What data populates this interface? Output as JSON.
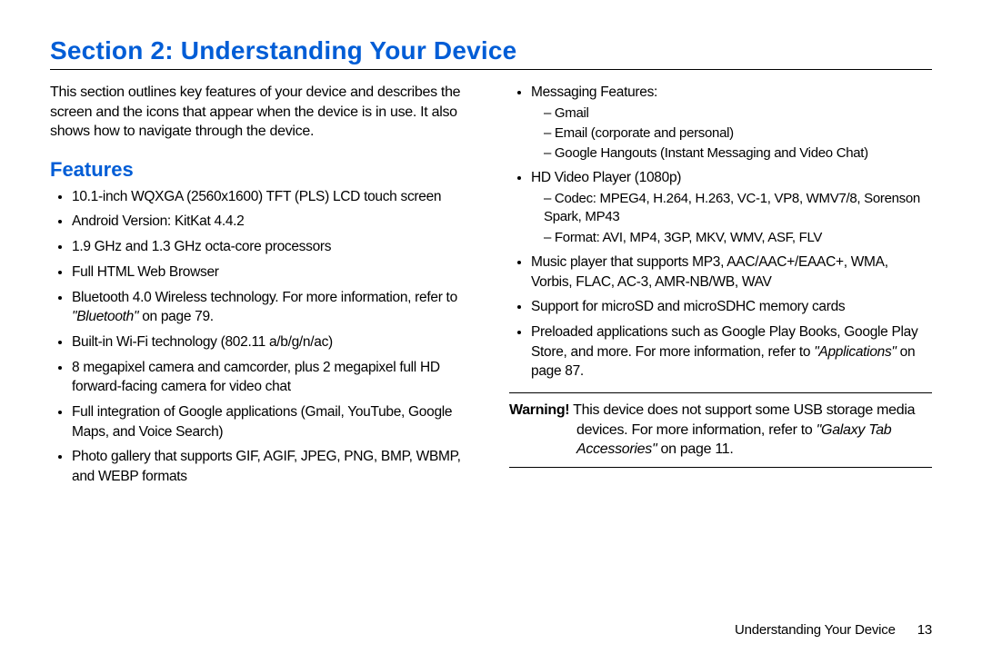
{
  "section_title": "Section 2: Understanding Your Device",
  "intro": "This section outlines key features of your device and describes the screen and the icons that appear when the device is in use. It also shows how to navigate through the device.",
  "features_heading": "Features",
  "left_bullets": {
    "b0": "10.1-inch WQXGA (2560x1600) TFT (PLS) LCD touch screen",
    "b1": "Android Version: KitKat 4.4.2",
    "b2": "1.9 GHz and 1.3 GHz octa-core processors",
    "b3": "Full HTML Web Browser",
    "b4_pre": "Bluetooth 4.0 Wireless technology. For more information, refer to ",
    "b4_ref": "\"Bluetooth\"",
    "b4_post": " on page 79.",
    "b5": "Built-in Wi-Fi technology (802.11 a/b/g/n/ac)",
    "b6": "8 megapixel camera and camcorder, plus 2 megapixel full HD forward-facing camera for video chat",
    "b7": "Full integration of Google applications (Gmail, YouTube, Google Maps, and Voice Search)",
    "b8": "Photo gallery that supports GIF, AGIF, JPEG, PNG, BMP, WBMP, and WEBP formats"
  },
  "right_bullets": {
    "msg_label": "Messaging Features:",
    "msg_items": {
      "m0": "Gmail",
      "m1": "Email (corporate and personal)",
      "m2": "Google Hangouts (Instant Messaging and Video Chat)"
    },
    "hd_label": "HD Video Player (1080p)",
    "hd_items": {
      "h0": "Codec: MPEG4, H.264, H.263, VC-1, VP8, WMV7/8, Sorenson Spark, MP43",
      "h1": "Format: AVI, MP4, 3GP, MKV, WMV, ASF, FLV"
    },
    "music": "Music player that supports MP3, AAC/AAC+/EAAC+, WMA, Vorbis, FLAC, AC-3, AMR-NB/WB, WAV",
    "sd": "Support for microSD and microSDHC memory cards",
    "preload_pre": "Preloaded applications such as Google Play Books, Google Play Store, and more. For more information, refer to ",
    "preload_ref": "\"Applications\"",
    "preload_post": " on page 87."
  },
  "warning": {
    "label": "Warning!",
    "text_pre": " This device does not support some USB storage media devices. For more information, refer to ",
    "ref": "\"Galaxy Tab Accessories\"",
    "text_post": " on page 11."
  },
  "footer": {
    "section_name": "Understanding Your Device",
    "page_number": "13"
  }
}
